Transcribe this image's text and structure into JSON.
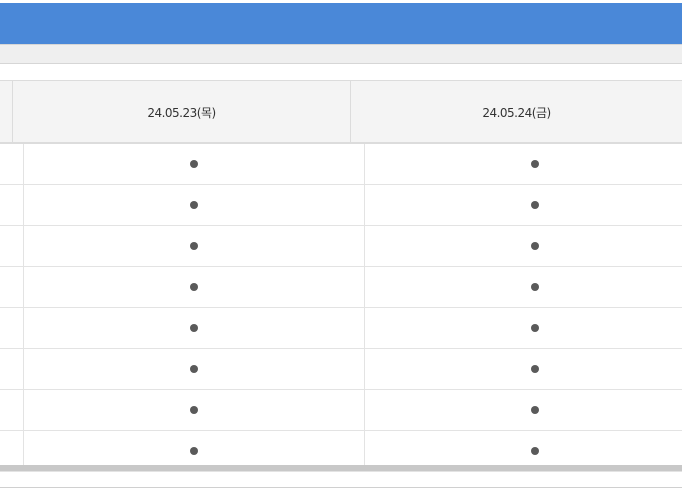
{
  "table": {
    "columns": [
      "24.05.23(목)",
      "24.05.24(금)"
    ],
    "rows": [
      [
        "●",
        "●"
      ],
      [
        "●",
        "●"
      ],
      [
        "●",
        "●"
      ],
      [
        "●",
        "●"
      ],
      [
        "●",
        "●"
      ],
      [
        "●",
        "●"
      ],
      [
        "●",
        "●"
      ],
      [
        "●",
        "●"
      ]
    ]
  }
}
